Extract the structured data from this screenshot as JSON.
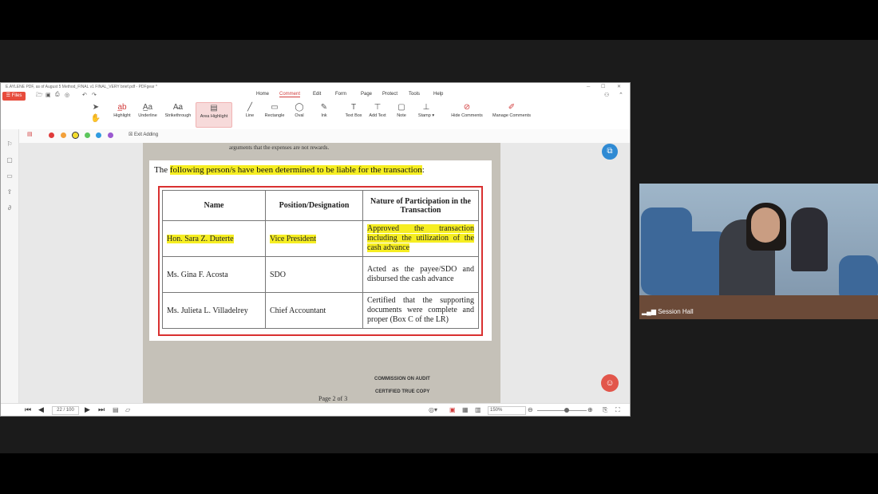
{
  "window": {
    "title": "E.AYLENE PDF, as of August 5 Method_FINAL v1 FINAL_VERY brief.pdf - PDFgear *",
    "files_label": "Files"
  },
  "menu": [
    "Home",
    "Comment",
    "Edit",
    "Form",
    "Page",
    "Protect",
    "Tools",
    "Help"
  ],
  "active_menu": "Comment",
  "toolbar": {
    "tools_left": [
      {
        "icon": "highlight-icon",
        "label": "Highlight"
      },
      {
        "icon": "underline-icon",
        "label": "Underline"
      },
      {
        "icon": "strikethrough-icon",
        "label": "Strikethrough"
      },
      {
        "icon": "area-highlight-icon",
        "label": "Area Highlight"
      }
    ],
    "tools_shape": [
      {
        "icon": "line-icon",
        "label": "Line"
      },
      {
        "icon": "rectangle-icon",
        "label": "Rectangle"
      },
      {
        "icon": "oval-icon",
        "label": "Oval"
      },
      {
        "icon": "ink-icon",
        "label": "Ink"
      }
    ],
    "tools_text": [
      {
        "icon": "text-box-icon",
        "label": "Text Box"
      },
      {
        "icon": "add-text-icon",
        "label": "Add Text"
      },
      {
        "icon": "note-icon",
        "label": "Note"
      },
      {
        "icon": "stamp-icon",
        "label": "Stamp ▾"
      }
    ],
    "tools_right": [
      {
        "icon": "hide-comments-icon",
        "label": "Hide Comments"
      },
      {
        "icon": "manage-comments-icon",
        "label": "Manage Comments"
      }
    ]
  },
  "subbar": {
    "colors": [
      "#e03a3a",
      "#f2a03a",
      "#f4dd2a",
      "#5cc65c",
      "#2f9be0",
      "#9b59d0"
    ],
    "exit_label": "Exit Adding"
  },
  "document": {
    "bg_top_line": "arguments that the expenses are not rewards.",
    "heading_pre": "The ",
    "heading_hl": "following person/s have been determined to be liable for the transaction",
    "heading_post": ":",
    "columns": [
      "Name",
      "Position/Designation",
      "Nature of Participation in the Transaction"
    ],
    "rows": [
      {
        "name": "Hon. Sara Z. Duterte",
        "position": "Vice President",
        "nature": "Approved the transaction including the utilization of the cash advance",
        "highlighted": true
      },
      {
        "name": "Ms. Gina F. Acosta",
        "position": "SDO",
        "nature": "Acted as the payee/SDO and disbursed the cash advance",
        "highlighted": false
      },
      {
        "name": "Ms. Julieta L. Villadelrey",
        "position": "Chief Accountant",
        "nature": "Certified that the supporting documents were complete and proper (Box C of the LR)",
        "highlighted": false
      }
    ],
    "bg_footer": {
      "commission": "COMMISSION ON AUDIT",
      "certified": "CERTIFIED TRUE COPY",
      "page": "Page 2 of 3"
    }
  },
  "statusbar": {
    "page_input": "22 / 100",
    "zoom": "150%"
  },
  "video": {
    "caption": "Session Hall"
  }
}
